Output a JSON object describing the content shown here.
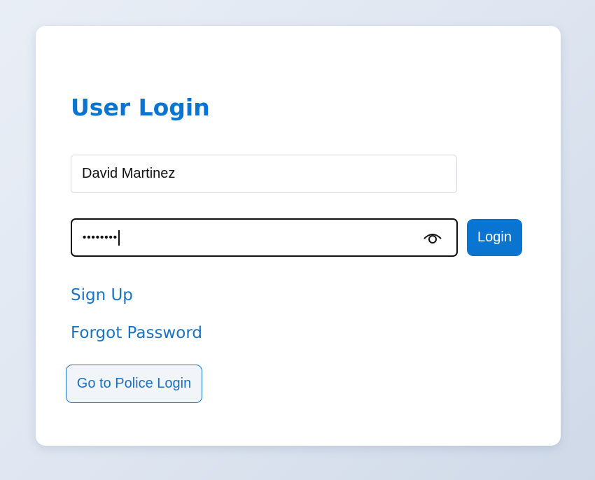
{
  "login": {
    "title": "User Login",
    "username_value": "David Martinez",
    "password_value": "••••••••",
    "login_button": "Login",
    "sign_up_link": "Sign Up",
    "forgot_password_link": "Forgot Password",
    "police_login_button": "Go to Police Login",
    "show_password_icon": "eye-icon"
  },
  "colors": {
    "accent": "#0a74d1",
    "link": "#1a73c4",
    "card_background": "#ffffff"
  }
}
